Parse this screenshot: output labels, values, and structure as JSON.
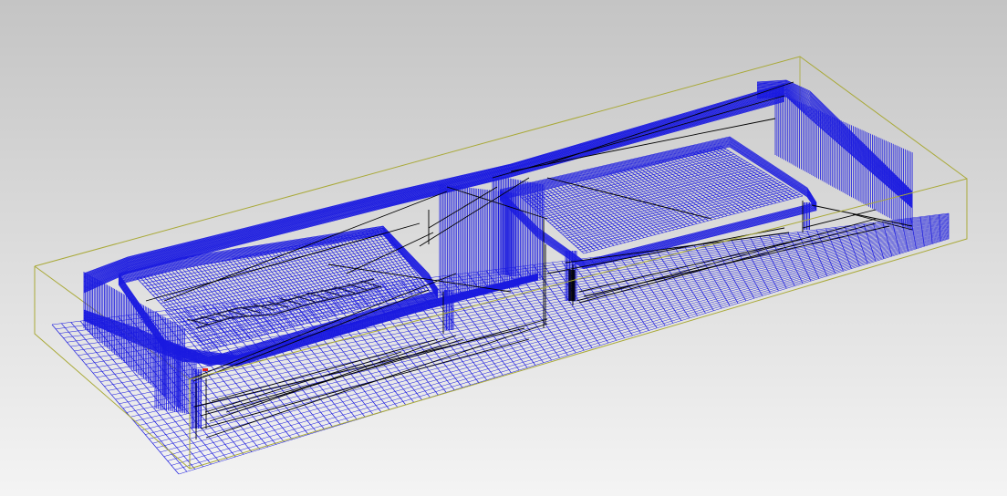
{
  "viewport": {
    "background_top": "#c4c4c4",
    "background_bottom": "#f4f4f4",
    "toolpath_color": "#1a1ae0",
    "rapid_color": "#000000",
    "stock_box_color": "#a9a937",
    "plunge_marker_color": "#e02020"
  },
  "scene": {
    "objects": [
      {
        "id": "stock-bounding-box",
        "icon": "wireframe-box"
      },
      {
        "id": "floor-pass",
        "icon": "raster-toolpath"
      },
      {
        "id": "outer-contour",
        "icon": "contour-toolpath"
      },
      {
        "id": "left-pocket",
        "icon": "pocket-toolpath"
      },
      {
        "id": "right-pocket",
        "icon": "pocket-toolpath"
      },
      {
        "id": "center-divider",
        "icon": "wall-toolpath"
      },
      {
        "id": "right-end-wall",
        "icon": "wall-toolpath"
      },
      {
        "id": "rapid-moves",
        "icon": "rapid-link"
      }
    ]
  }
}
